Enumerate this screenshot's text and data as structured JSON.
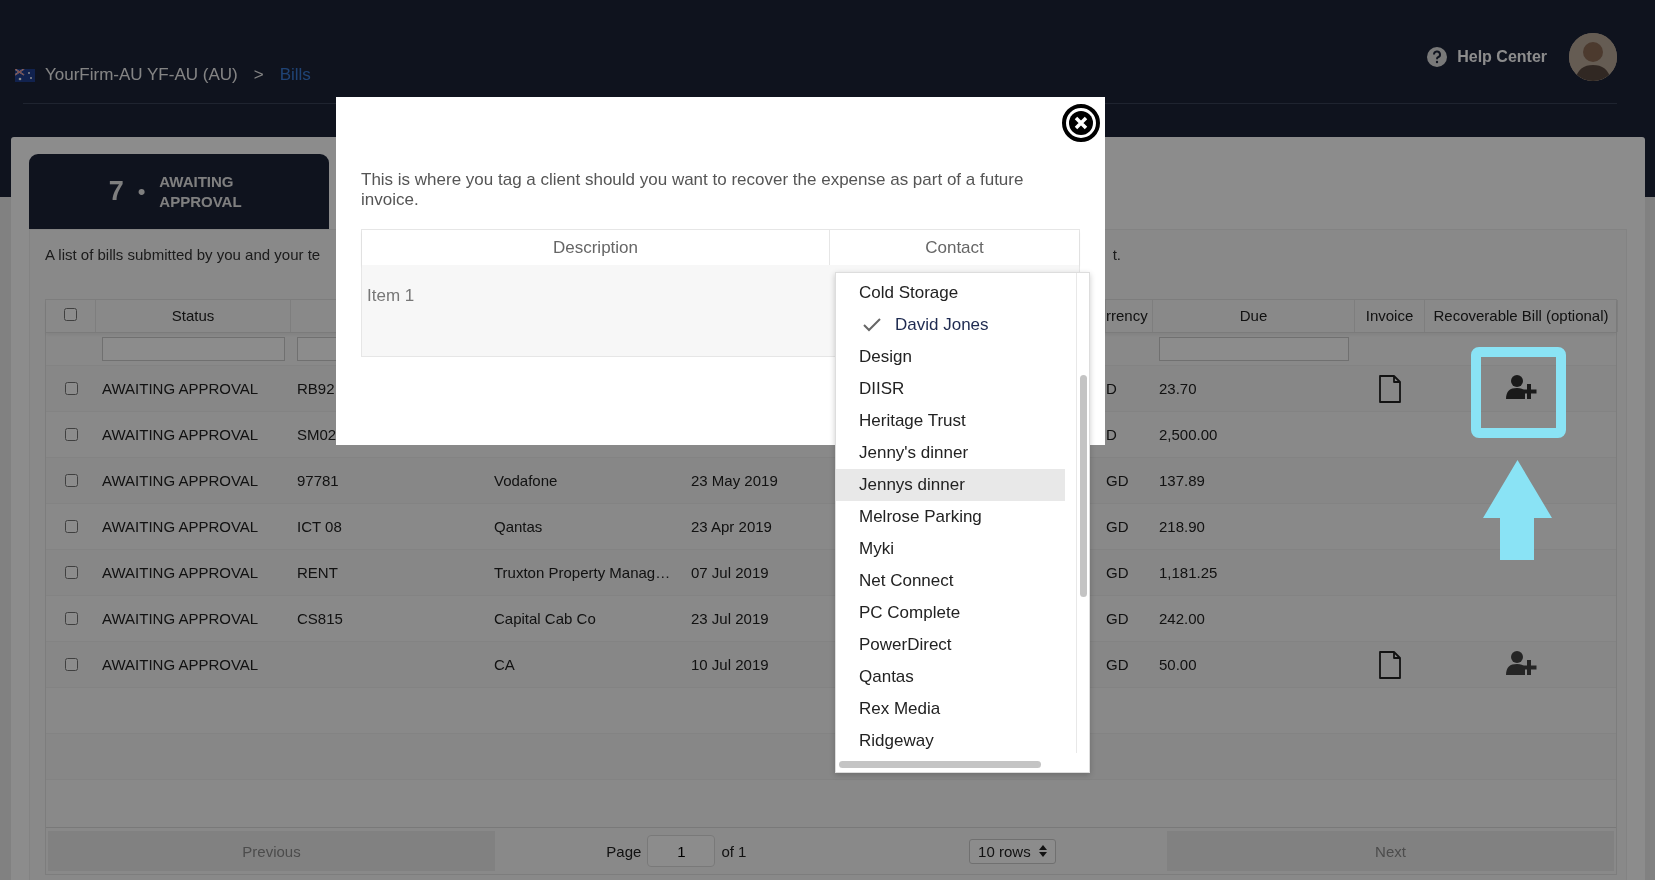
{
  "header": {
    "breadcrumb": {
      "org": "YourFirm-AU YF-AU (AU)",
      "separator": ">",
      "current": "Bills"
    },
    "help": "Help Center"
  },
  "status_tab": {
    "count": "7",
    "bullet": "•",
    "label": "AWAITING APPROVAL"
  },
  "description": {
    "start": "A list of bills submitted by you and your te",
    "end": "t."
  },
  "table": {
    "select_all": {
      "checked": false
    },
    "columns": {
      "status": "Status",
      "currency": "rrency",
      "due": "Due",
      "invoice": "Invoice",
      "recoverable": "Recoverable Bill (optional)"
    },
    "rows": [
      {
        "checked": false,
        "status": "AWAITING APPROVAL",
        "ref": "RB92",
        "currency": "D",
        "due": "23.70",
        "invoice": true,
        "recoverable": true,
        "highlighted": true
      },
      {
        "checked": false,
        "status": "AWAITING APPROVAL",
        "ref": "SM02",
        "currency": "D",
        "due": "2,500.00",
        "invoice": false,
        "recoverable": false,
        "highlighted": false
      },
      {
        "checked": false,
        "status": "AWAITING APPROVAL",
        "ref": "97781",
        "supplier": "Vodafone",
        "date": "23 May 2019",
        "currency": "GD",
        "due": "137.89",
        "invoice": false,
        "recoverable": false,
        "highlighted": false
      },
      {
        "checked": false,
        "status": "AWAITING APPROVAL",
        "ref": "ICT 08",
        "supplier": "Qantas",
        "date": "23 Apr 2019",
        "currency": "GD",
        "due": "218.90",
        "invoice": false,
        "recoverable": false,
        "highlighted": false
      },
      {
        "checked": false,
        "status": "AWAITING APPROVAL",
        "ref": "RENT",
        "supplier": "Truxton Property Manag…",
        "date": "07 Jul 2019",
        "currency": "GD",
        "due": "1,181.25",
        "invoice": false,
        "recoverable": false,
        "highlighted": false
      },
      {
        "checked": false,
        "status": "AWAITING APPROVAL",
        "ref": "CS815",
        "supplier": "Capital Cab Co",
        "date": "23 Jul 2019",
        "currency": "GD",
        "due": "242.00",
        "invoice": false,
        "recoverable": false,
        "highlighted": false
      },
      {
        "checked": false,
        "status": "AWAITING APPROVAL",
        "supplier": "CA",
        "date": "10 Jul 2019",
        "currency": "GD",
        "due": "50.00",
        "invoice": true,
        "recoverable": true,
        "highlighted": false
      }
    ]
  },
  "pagination": {
    "previous": {
      "label": "Previous",
      "disabled": true
    },
    "page_label": "Page",
    "page": "1",
    "of": "of 1",
    "rows": "10 rows",
    "next": {
      "label": "Next",
      "disabled": true
    }
  },
  "modal": {
    "intro": "This is where you tag a client should you want to recover the expense as part of a future invoice.",
    "columns": [
      "Description",
      "Contact"
    ],
    "rows": [
      {
        "description": "Item 1"
      }
    ]
  },
  "dropdown": {
    "options": [
      {
        "label": "Cold Storage",
        "selected": false,
        "hovered": false
      },
      {
        "label": "David Jones",
        "selected": true,
        "hovered": false
      },
      {
        "label": "Design",
        "selected": false,
        "hovered": false
      },
      {
        "label": "DIISR",
        "selected": false,
        "hovered": false
      },
      {
        "label": "Heritage Trust",
        "selected": false,
        "hovered": false
      },
      {
        "label": "Jenny's dinner",
        "selected": false,
        "hovered": false
      },
      {
        "label": "Jennys dinner",
        "selected": false,
        "hovered": true
      },
      {
        "label": "Melrose Parking",
        "selected": false,
        "hovered": false
      },
      {
        "label": "Myki",
        "selected": false,
        "hovered": false
      },
      {
        "label": "Net Connect",
        "selected": false,
        "hovered": false
      },
      {
        "label": "PC Complete",
        "selected": false,
        "hovered": false
      },
      {
        "label": "PowerDirect",
        "selected": false,
        "hovered": false
      },
      {
        "label": "Qantas",
        "selected": false,
        "hovered": false
      },
      {
        "label": "Rex Media",
        "selected": false,
        "hovered": false
      },
      {
        "label": "Ridgeway",
        "selected": false,
        "hovered": false
      }
    ]
  }
}
